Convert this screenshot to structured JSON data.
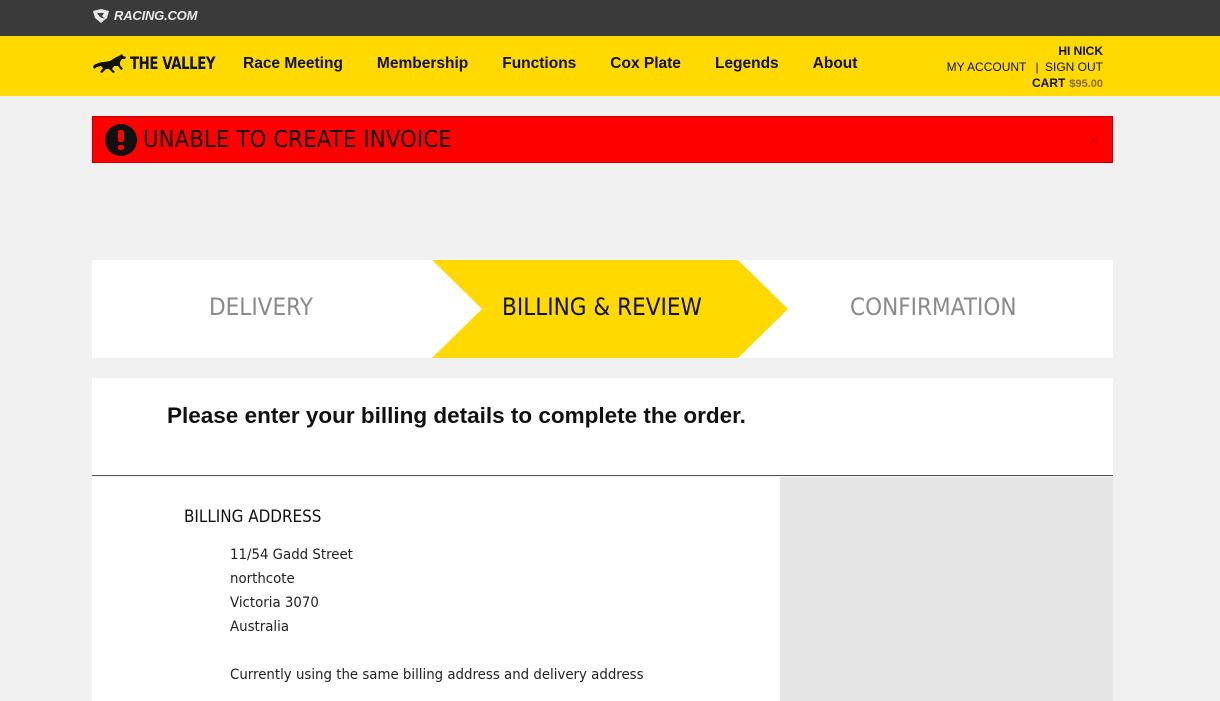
{
  "topbar": {
    "brand": "RACING.COM"
  },
  "nav": {
    "logo_text": "THE VALLEY",
    "links": [
      "Race Meeting",
      "Membership",
      "Functions",
      "Cox Plate",
      "Legends",
      "About"
    ],
    "account": {
      "greeting": "HI NICK",
      "my_account": "MY ACCOUNT",
      "separator": "|",
      "sign_out": "SIGN OUT",
      "cart_label": "CART",
      "cart_amount": "$95.00"
    }
  },
  "error": {
    "message": "UNABLE TO CREATE INVOICE",
    "close": "×"
  },
  "steps": {
    "delivery": "DELIVERY",
    "billing": "BILLING & REVIEW",
    "confirmation": "CONFIRMATION",
    "active": "BILLING & REVIEW"
  },
  "billing": {
    "heading": "Please enter your billing details to complete the order.",
    "section_title": "BILLING ADDRESS",
    "address": [
      "11/54 Gadd Street",
      "northcote",
      "Victoria 3070",
      "Australia"
    ],
    "note": "Currently using the same billing address and delivery address"
  },
  "colors": {
    "nav": "#ffd900",
    "error": "#ff0000",
    "topbar": "#3a3a3a",
    "active_step": "#ffd900"
  }
}
